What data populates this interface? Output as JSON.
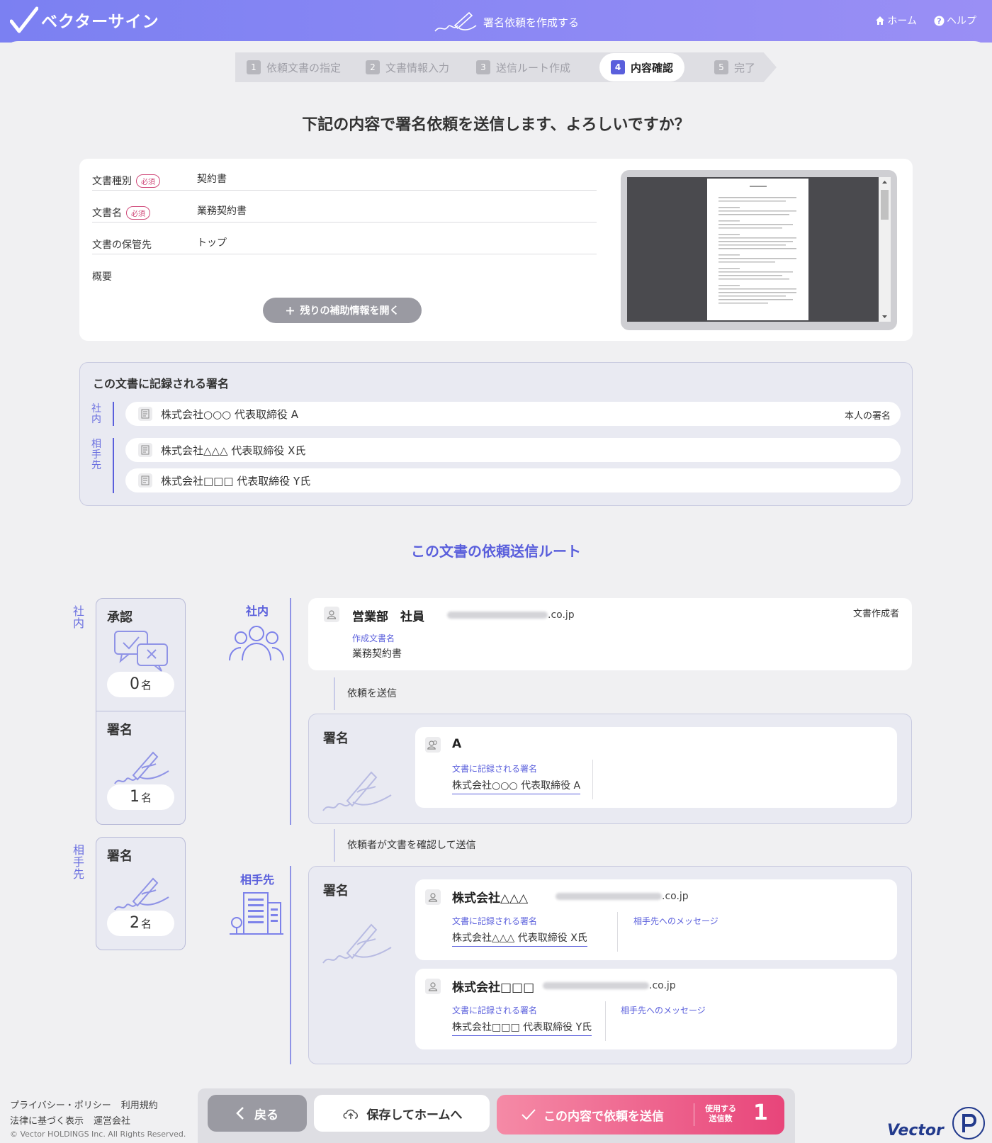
{
  "header": {
    "logo_text": "ベクターサイン",
    "title": "署名依頼を作成する",
    "home": "ホーム",
    "help": "ヘルプ"
  },
  "steps": [
    {
      "num": "1",
      "label": "依頼文書の指定"
    },
    {
      "num": "2",
      "label": "文書情報入力"
    },
    {
      "num": "3",
      "label": "送信ルート作成"
    },
    {
      "num": "4",
      "label": "内容確認"
    },
    {
      "num": "5",
      "label": "完了"
    }
  ],
  "question": "下記の内容で署名依頼を送信します、よろしいですか？",
  "doc_info": {
    "required_tag": "必須",
    "fields": [
      {
        "label": "文書種別",
        "value": "契約書"
      },
      {
        "label": "文書名",
        "value": "業務契約書"
      },
      {
        "label": "文書の保管先",
        "value": "トップ"
      },
      {
        "label": "概要",
        "value": ""
      }
    ],
    "more_button": "残りの補助情報を開く"
  },
  "signatures": {
    "title": "この文書に記録される署名",
    "internal_label": "社内",
    "partner_label": "相手先",
    "internal": [
      {
        "name": "株式会社○○○ 代表取締役 A",
        "tag": "本人の署名"
      }
    ],
    "partner": [
      {
        "name": "株式会社△△△ 代表取締役 X氏"
      },
      {
        "name": "株式会社□□□ 代表取締役 Y氏"
      }
    ]
  },
  "route": {
    "title": "この文書の依頼送信ルート",
    "summary": {
      "internal_label": "社内",
      "partner_label": "相手先",
      "approve_title": "承認",
      "approve_count": "0",
      "sign_title": "署名",
      "sign_count": "1",
      "partner_sign_title": "署名",
      "partner_sign_count": "2",
      "unit": "名"
    },
    "group_internal": "社内",
    "group_partner": "相手先",
    "creator": {
      "dept": "営業部",
      "role": "社員",
      "email_domain": ".co.jp",
      "tag": "文書作成者",
      "doc_label": "作成文書名",
      "doc_value": "業務契約書"
    },
    "note1": "依頼を送信",
    "internal_step": {
      "title": "署名",
      "person": "A",
      "sig_label": "文書に記録される署名",
      "sig_value": "株式会社○○○ 代表取締役 A"
    },
    "note2": "依頼者が文書を確認して送信",
    "partner_step": {
      "title": "署名",
      "persons": [
        {
          "company": "株式会社△△△",
          "email_domain": ".co.jp",
          "sig_label": "文書に記録される署名",
          "sig_value": "株式会社△△△ 代表取締役 X氏",
          "msg_label": "相手先へのメッセージ"
        },
        {
          "company": "株式会社□□□",
          "email_domain": ".co.jp",
          "sig_label": "文書に記録される署名",
          "sig_value": "株式会社□□□ 代表取締役 Y氏",
          "msg_label": "相手先へのメッセージ"
        }
      ]
    }
  },
  "footer": {
    "links": [
      "プライバシー・ポリシー",
      "利用規約",
      "法律に基づく表示",
      "運営会社"
    ],
    "copyright": "© Vector HOLDINGS Inc. All Rights Reserved.",
    "vector": "Vector"
  },
  "actions": {
    "back": "戻る",
    "save": "保存してホームへ",
    "send": "この内容で依頼を送信",
    "send_sub1": "使用する",
    "send_sub2": "送信数",
    "send_count": "1"
  },
  "colors": {
    "accent": "#5a5fdc",
    "header_from": "#7b80f2",
    "header_to": "#9a8ff5",
    "send_from": "#f58aa6",
    "send_to": "#e8457a",
    "required": "#d04a7a"
  }
}
